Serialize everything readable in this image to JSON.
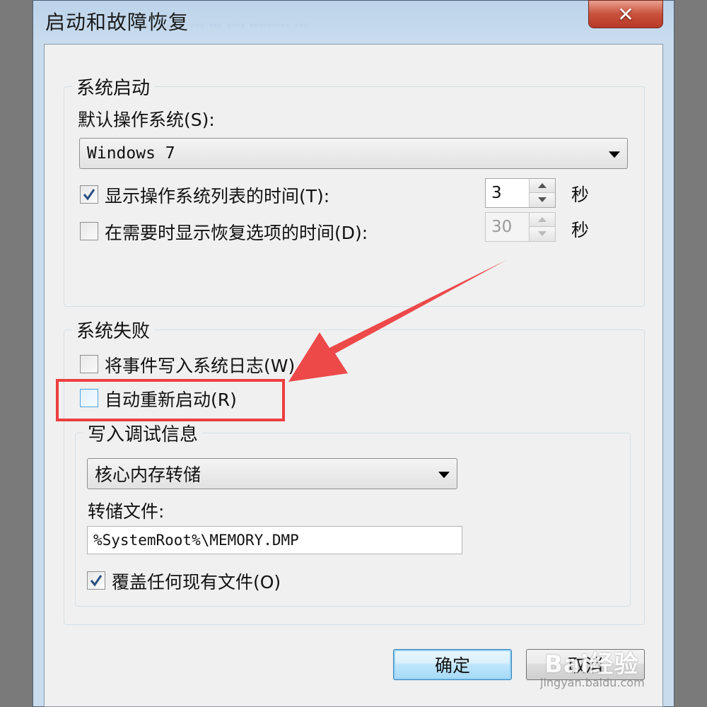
{
  "window": {
    "title": "启动和故障恢复",
    "background_title": "...  ...  .... ......... ..."
  },
  "system_startup": {
    "legend": "系统启动",
    "default_os_label": "默认操作系统(S):",
    "default_os_value": "Windows 7",
    "show_list_time": {
      "label": "显示操作系统列表的时间(T):",
      "checked": true,
      "value": "3",
      "unit": "秒"
    },
    "show_recovery_time": {
      "label": "在需要时显示恢复选项的时间(D):",
      "checked": false,
      "value": "30",
      "unit": "秒"
    }
  },
  "system_failure": {
    "legend": "系统失败",
    "write_event": {
      "label": "将事件写入系统日志(W)",
      "checked": false
    },
    "auto_restart": {
      "label": "自动重新启动(R)",
      "checked": false
    },
    "debug_info": {
      "legend": "写入调试信息",
      "dump_type": "核心内存转储",
      "dump_file_label": "转储文件:",
      "dump_file_value": "%SystemRoot%\\MEMORY.DMP",
      "overwrite": {
        "label": "覆盖任何现有文件(O)",
        "checked": true
      }
    }
  },
  "buttons": {
    "ok": "确定",
    "cancel": "取消"
  },
  "annotation": {
    "color": "#ec3f3f"
  },
  "watermark": {
    "text": "Bai经验",
    "url": "jingyan.baidu.com"
  },
  "colors": {
    "accent": "#3c7fb1",
    "close": "#c9513c",
    "highlight": "#ec3f3f"
  },
  "icons": {
    "close": "close-icon",
    "check": "checkmark-icon",
    "dropdown": "chevron-down-icon",
    "arrow": "red-arrow-icon"
  }
}
